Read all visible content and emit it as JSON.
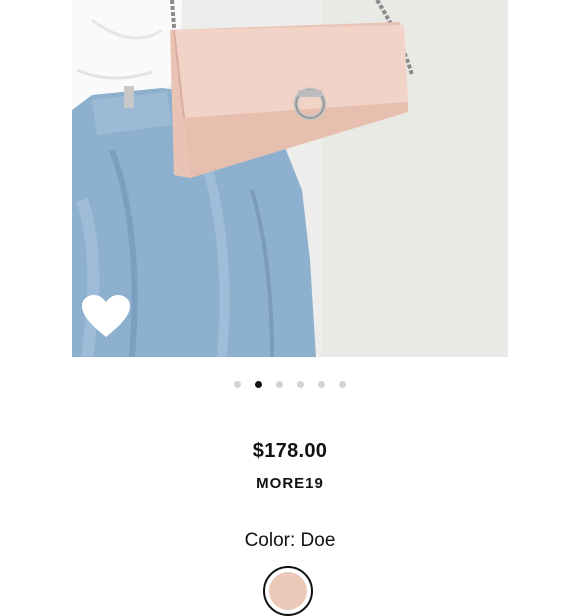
{
  "product": {
    "price": "$178.00",
    "promo_code": "MORE19",
    "color_label": "Color:",
    "color_value": "Doe",
    "swatch_color": "#ecc8b8"
  },
  "gallery": {
    "image_count": 6,
    "active_index": 1
  },
  "icons": {
    "wishlist": "heart-icon"
  },
  "colors": {
    "bag": "#efcfc3",
    "denim": "#8fb1cf",
    "shirt": "#ffffff",
    "text": "#111111",
    "dot_inactive": "#d3d3d3"
  }
}
